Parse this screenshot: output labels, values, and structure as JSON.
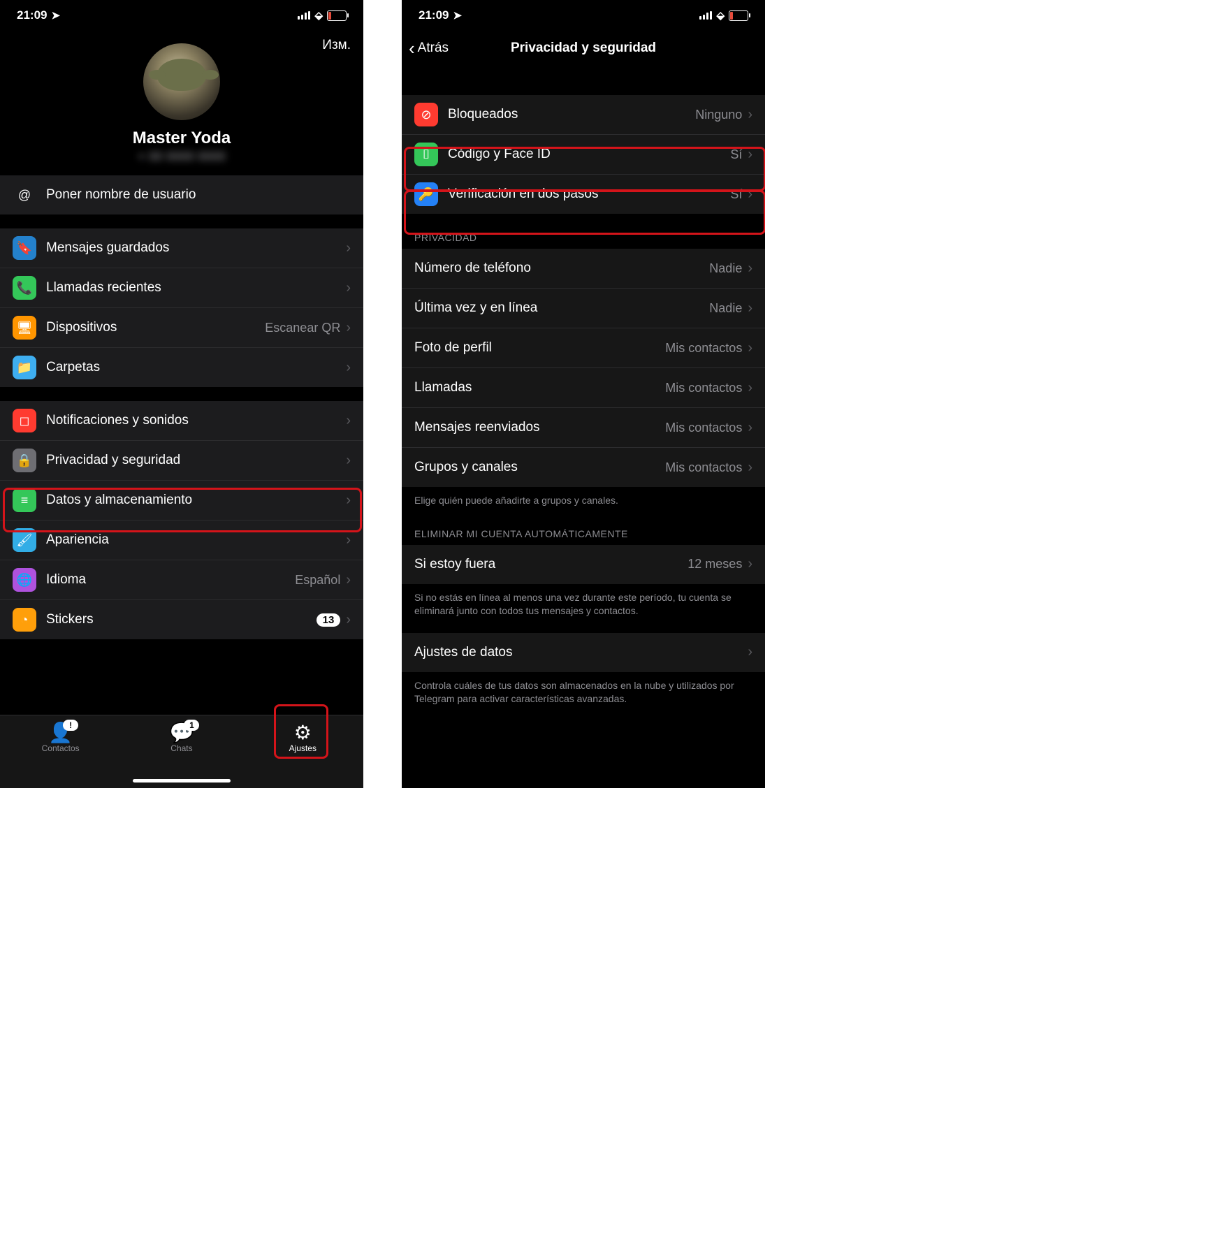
{
  "status": {
    "time": "21:09"
  },
  "left": {
    "edit": "Изм.",
    "name": "Master Yoda",
    "username_row": "Poner nombre de usuario",
    "group1": [
      {
        "icon": "🔖",
        "bg": "bg-blue",
        "label": "Mensajes guardados",
        "value": ""
      },
      {
        "icon": "📞",
        "bg": "bg-green",
        "label": "Llamadas recientes",
        "value": ""
      },
      {
        "icon": "🖥",
        "bg": "bg-orange",
        "label": "Dispositivos",
        "value": "Escanear QR"
      },
      {
        "icon": "📁",
        "bg": "bg-lightblue",
        "label": "Carpetas",
        "value": ""
      }
    ],
    "group2": [
      {
        "icon": "◻",
        "bg": "bg-red",
        "label": "Notificaciones y sonidos",
        "value": ""
      },
      {
        "icon": "🔒",
        "bg": "bg-gray",
        "label": "Privacidad y seguridad",
        "value": ""
      },
      {
        "icon": "≡",
        "bg": "bg-green",
        "label": "Datos y almacenamiento",
        "value": ""
      },
      {
        "icon": "🖌",
        "bg": "bg-cyan",
        "label": "Apariencia",
        "value": ""
      },
      {
        "icon": "🌐",
        "bg": "bg-purple",
        "label": "Idioma",
        "value": "Español"
      },
      {
        "icon": "◔",
        "bg": "bg-yellow",
        "label": "Stickers",
        "badge": "13"
      }
    ],
    "tabs": {
      "contacts": "Contactos",
      "chats": "Chats",
      "chats_badge": "1",
      "settings": "Ajustes"
    }
  },
  "right": {
    "back": "Atrás",
    "title": "Privacidad y seguridad",
    "security": [
      {
        "icon": "⊘",
        "bg": "bg-red",
        "label": "Bloqueados",
        "value": "Ninguno"
      },
      {
        "icon": "⌷",
        "bg": "bg-face",
        "label": "Código y Face ID",
        "value": "Sí"
      },
      {
        "icon": "🔑",
        "bg": "bg-key",
        "label": "Verificación en dos pasos",
        "value": "Sí"
      }
    ],
    "privacy_header": "PRIVACIDAD",
    "privacy": [
      {
        "label": "Número de teléfono",
        "value": "Nadie"
      },
      {
        "label": "Última vez y en línea",
        "value": "Nadie"
      },
      {
        "label": "Foto de perfil",
        "value": "Mis contactos"
      },
      {
        "label": "Llamadas",
        "value": "Mis contactos"
      },
      {
        "label": "Mensajes reenviados",
        "value": "Mis contactos"
      },
      {
        "label": "Grupos y canales",
        "value": "Mis contactos"
      }
    ],
    "privacy_footer": "Elige quién puede añadirte a grupos y canales.",
    "delete_header": "ELIMINAR MI CUENTA AUTOMÁTICAMENTE",
    "delete_row": {
      "label": "Si estoy fuera",
      "value": "12 meses"
    },
    "delete_footer": "Si no estás en línea al menos una vez durante este período, tu cuenta se eliminará junto con todos tus mensajes y contactos.",
    "data_row": "Ajustes de datos",
    "data_footer": "Controla cuáles de tus datos son almacenados en la nube y utilizados por Telegram para activar características avanzadas."
  }
}
